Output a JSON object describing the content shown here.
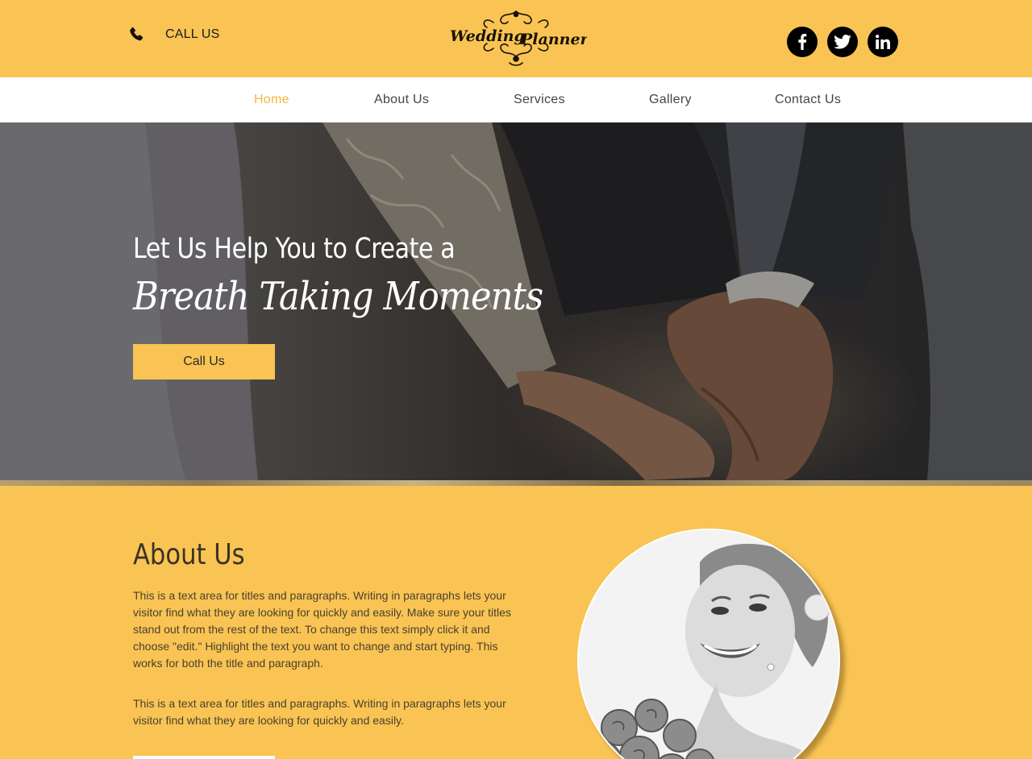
{
  "header": {
    "call_label": "CALL US",
    "logo_text_1": "Wedding",
    "logo_text_2": "Planner",
    "social": [
      "facebook-icon",
      "twitter-icon",
      "linkedin-icon"
    ]
  },
  "nav": {
    "items": [
      {
        "label": "Home",
        "active": true
      },
      {
        "label": "About Us",
        "active": false
      },
      {
        "label": "Services",
        "active": false
      },
      {
        "label": "Gallery",
        "active": false
      },
      {
        "label": "Contact Us",
        "active": false
      }
    ]
  },
  "hero": {
    "title": "Let Us Help You to Create a",
    "script": "Breath Taking Moments",
    "button_label": "Call Us"
  },
  "about": {
    "title": "About Us",
    "paragraph_1": "This is a text area for titles and paragraphs. Writing in paragraphs lets your visitor find what they are looking for quickly and easily. Make sure your titles stand out from the rest of the text. To change this text simply click it and choose \"edit.\" Highlight the text you want to change and start typing. This works for both the title and paragraph.",
    "paragraph_2": "This is a text area for titles and paragraphs. Writing in paragraphs lets your visitor find what they are looking for quickly and easily."
  },
  "colors": {
    "accent": "#f9c453",
    "active_nav": "#f4b93e",
    "dark": "#000000"
  }
}
